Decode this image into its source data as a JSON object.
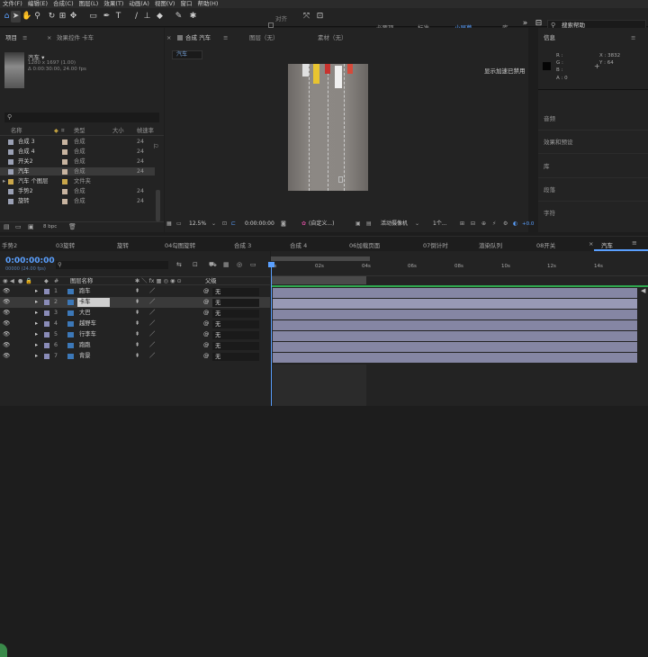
{
  "menu": [
    "文件(F)",
    "编辑(E)",
    "合成(C)",
    "图层(L)",
    "效果(T)",
    "动画(A)",
    "视图(V)",
    "窗口",
    "帮助(H)"
  ],
  "toolbar": {
    "align_label": "对齐",
    "workspaces": [
      "必要项",
      "标准",
      "小屏幕",
      "库"
    ],
    "active_workspace": "小屏幕",
    "search_placeholder": "搜索帮助"
  },
  "project": {
    "tab": "项目",
    "effect_tab": "效果控件 卡车",
    "item_name": "汽车 ▾",
    "item_size": "1280 x 1697 (1.00)",
    "item_duration": "Δ 0:00:30:00, 24.00 fps",
    "columns": [
      "名称",
      "类型",
      "大小",
      "帧速率"
    ],
    "items": [
      {
        "name": "合成 3",
        "type": "合成",
        "fps": "24"
      },
      {
        "name": "合成 4",
        "type": "合成",
        "fps": "24"
      },
      {
        "name": "开关2",
        "type": "合成",
        "fps": "24"
      },
      {
        "name": "汽车",
        "type": "合成",
        "fps": "24"
      },
      {
        "name": "汽车 个图层",
        "type": "文件夹",
        "fps": ""
      },
      {
        "name": "手势2",
        "type": "合成",
        "fps": "24"
      },
      {
        "name": "旋转",
        "type": "合成",
        "fps": "24"
      }
    ],
    "bpc": "8 bpc"
  },
  "comp_tabs": {
    "comp": "合成 汽车",
    "layer": "图层（无）",
    "footage": "素材（无）",
    "breadcrumb": "汽车"
  },
  "viewer": {
    "gpu_msg": "显示加速已禁用",
    "zoom": "12.5%",
    "timecode": "0:00:00:00",
    "view_mode": "(自定义...)",
    "camera": "活动摄像机",
    "views": "1个...",
    "offset": "+0.0"
  },
  "info": {
    "title": "信息",
    "r": "R :",
    "g": "G :",
    "b": "B :",
    "a": "A : 0",
    "x": "X : 3832",
    "y": "Y : 64"
  },
  "right_panels": [
    "音频",
    "效果和预设",
    "库",
    "段落",
    "字符"
  ],
  "timeline": {
    "tabs": [
      "手势2",
      "03旋转",
      "旋转",
      "04勾图旋转",
      "合成 3",
      "合成 4",
      "06加载页面",
      "07倒计时",
      "渲染队列",
      "08开关",
      "汽车"
    ],
    "active_tab": "汽车",
    "timecode": "0:00:00:00",
    "timecode_sub": "00000 (24.00 fps)",
    "col_layer": "图层名称",
    "col_parent": "父级",
    "ruler": [
      "0s",
      "02s",
      "04s",
      "06s",
      "08s",
      "10s",
      "12s",
      "14s"
    ],
    "layers": [
      {
        "num": "1",
        "name": "跑车",
        "parent": "无",
        "color": "#8a8cb8"
      },
      {
        "num": "2",
        "name": "卡车",
        "parent": "无",
        "color": "#8a8cb8"
      },
      {
        "num": "3",
        "name": "大巴",
        "parent": "无",
        "color": "#8a8cb8"
      },
      {
        "num": "4",
        "name": "越野车",
        "parent": "无",
        "color": "#8a8cb8"
      },
      {
        "num": "5",
        "name": "行李车",
        "parent": "无",
        "color": "#8a8cb8"
      },
      {
        "num": "6",
        "name": "跑跑",
        "parent": "无",
        "color": "#8a8cb8"
      },
      {
        "num": "7",
        "name": "背景",
        "parent": "无",
        "color": "#8a8cb8"
      }
    ]
  }
}
